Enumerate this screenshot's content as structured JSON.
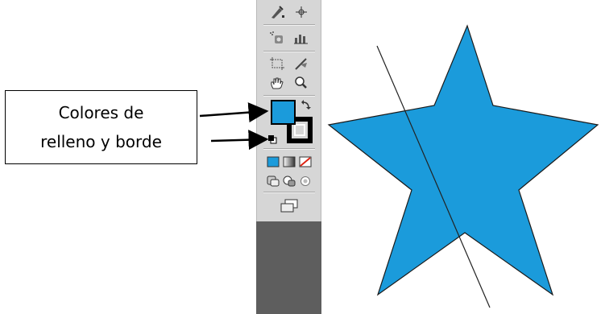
{
  "callout": {
    "line1": "Colores de",
    "line2": "relleno y borde"
  },
  "colors": {
    "fill": "#1b9bdb",
    "stroke": "#000000",
    "toolbar_bg": "#d6d6d6",
    "toolbar_dark": "#5e5e5e"
  },
  "toolbar": {
    "tools": [
      "pen-icon",
      "transform-icon",
      "symbol-sprayer-icon",
      "graph-icon",
      "artboard-icon",
      "slice-icon",
      "hand-icon",
      "zoom-icon",
      "fill-swatch",
      "stroke-swatch",
      "swap-colors-icon",
      "default-colors-icon",
      "color-mode-icon",
      "gradient-mode-icon",
      "none-mode-icon",
      "draw-normal-icon",
      "draw-behind-icon",
      "draw-inside-icon",
      "screen-mode-icon"
    ]
  },
  "canvas": {
    "shape": "star",
    "guide": "line"
  }
}
